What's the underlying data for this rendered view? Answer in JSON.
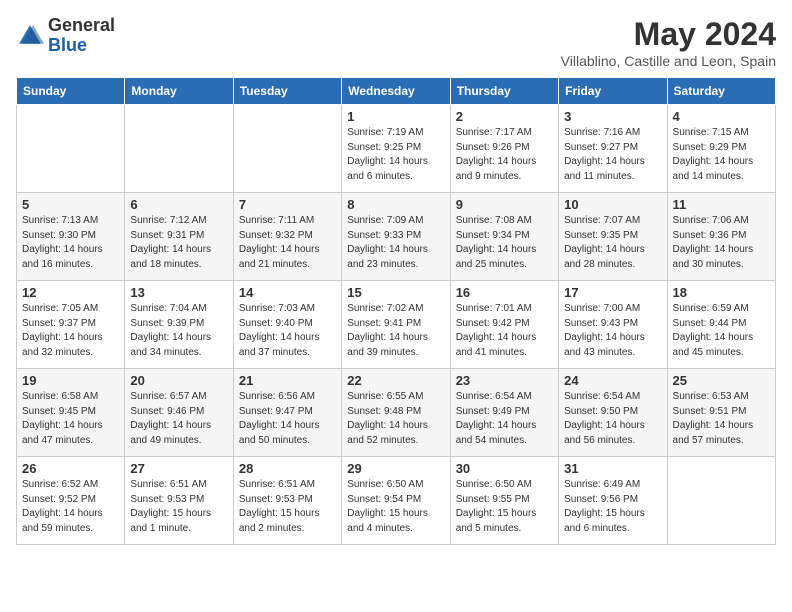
{
  "header": {
    "logo_general": "General",
    "logo_blue": "Blue",
    "month_year": "May 2024",
    "location": "Villablino, Castille and Leon, Spain"
  },
  "weekdays": [
    "Sunday",
    "Monday",
    "Tuesday",
    "Wednesday",
    "Thursday",
    "Friday",
    "Saturday"
  ],
  "weeks": [
    [
      {
        "day": "",
        "detail": ""
      },
      {
        "day": "",
        "detail": ""
      },
      {
        "day": "",
        "detail": ""
      },
      {
        "day": "1",
        "detail": "Sunrise: 7:19 AM\nSunset: 9:25 PM\nDaylight: 14 hours\nand 6 minutes."
      },
      {
        "day": "2",
        "detail": "Sunrise: 7:17 AM\nSunset: 9:26 PM\nDaylight: 14 hours\nand 9 minutes."
      },
      {
        "day": "3",
        "detail": "Sunrise: 7:16 AM\nSunset: 9:27 PM\nDaylight: 14 hours\nand 11 minutes."
      },
      {
        "day": "4",
        "detail": "Sunrise: 7:15 AM\nSunset: 9:29 PM\nDaylight: 14 hours\nand 14 minutes."
      }
    ],
    [
      {
        "day": "5",
        "detail": "Sunrise: 7:13 AM\nSunset: 9:30 PM\nDaylight: 14 hours\nand 16 minutes."
      },
      {
        "day": "6",
        "detail": "Sunrise: 7:12 AM\nSunset: 9:31 PM\nDaylight: 14 hours\nand 18 minutes."
      },
      {
        "day": "7",
        "detail": "Sunrise: 7:11 AM\nSunset: 9:32 PM\nDaylight: 14 hours\nand 21 minutes."
      },
      {
        "day": "8",
        "detail": "Sunrise: 7:09 AM\nSunset: 9:33 PM\nDaylight: 14 hours\nand 23 minutes."
      },
      {
        "day": "9",
        "detail": "Sunrise: 7:08 AM\nSunset: 9:34 PM\nDaylight: 14 hours\nand 25 minutes."
      },
      {
        "day": "10",
        "detail": "Sunrise: 7:07 AM\nSunset: 9:35 PM\nDaylight: 14 hours\nand 28 minutes."
      },
      {
        "day": "11",
        "detail": "Sunrise: 7:06 AM\nSunset: 9:36 PM\nDaylight: 14 hours\nand 30 minutes."
      }
    ],
    [
      {
        "day": "12",
        "detail": "Sunrise: 7:05 AM\nSunset: 9:37 PM\nDaylight: 14 hours\nand 32 minutes."
      },
      {
        "day": "13",
        "detail": "Sunrise: 7:04 AM\nSunset: 9:39 PM\nDaylight: 14 hours\nand 34 minutes."
      },
      {
        "day": "14",
        "detail": "Sunrise: 7:03 AM\nSunset: 9:40 PM\nDaylight: 14 hours\nand 37 minutes."
      },
      {
        "day": "15",
        "detail": "Sunrise: 7:02 AM\nSunset: 9:41 PM\nDaylight: 14 hours\nand 39 minutes."
      },
      {
        "day": "16",
        "detail": "Sunrise: 7:01 AM\nSunset: 9:42 PM\nDaylight: 14 hours\nand 41 minutes."
      },
      {
        "day": "17",
        "detail": "Sunrise: 7:00 AM\nSunset: 9:43 PM\nDaylight: 14 hours\nand 43 minutes."
      },
      {
        "day": "18",
        "detail": "Sunrise: 6:59 AM\nSunset: 9:44 PM\nDaylight: 14 hours\nand 45 minutes."
      }
    ],
    [
      {
        "day": "19",
        "detail": "Sunrise: 6:58 AM\nSunset: 9:45 PM\nDaylight: 14 hours\nand 47 minutes."
      },
      {
        "day": "20",
        "detail": "Sunrise: 6:57 AM\nSunset: 9:46 PM\nDaylight: 14 hours\nand 49 minutes."
      },
      {
        "day": "21",
        "detail": "Sunrise: 6:56 AM\nSunset: 9:47 PM\nDaylight: 14 hours\nand 50 minutes."
      },
      {
        "day": "22",
        "detail": "Sunrise: 6:55 AM\nSunset: 9:48 PM\nDaylight: 14 hours\nand 52 minutes."
      },
      {
        "day": "23",
        "detail": "Sunrise: 6:54 AM\nSunset: 9:49 PM\nDaylight: 14 hours\nand 54 minutes."
      },
      {
        "day": "24",
        "detail": "Sunrise: 6:54 AM\nSunset: 9:50 PM\nDaylight: 14 hours\nand 56 minutes."
      },
      {
        "day": "25",
        "detail": "Sunrise: 6:53 AM\nSunset: 9:51 PM\nDaylight: 14 hours\nand 57 minutes."
      }
    ],
    [
      {
        "day": "26",
        "detail": "Sunrise: 6:52 AM\nSunset: 9:52 PM\nDaylight: 14 hours\nand 59 minutes."
      },
      {
        "day": "27",
        "detail": "Sunrise: 6:51 AM\nSunset: 9:53 PM\nDaylight: 15 hours\nand 1 minute."
      },
      {
        "day": "28",
        "detail": "Sunrise: 6:51 AM\nSunset: 9:53 PM\nDaylight: 15 hours\nand 2 minutes."
      },
      {
        "day": "29",
        "detail": "Sunrise: 6:50 AM\nSunset: 9:54 PM\nDaylight: 15 hours\nand 4 minutes."
      },
      {
        "day": "30",
        "detail": "Sunrise: 6:50 AM\nSunset: 9:55 PM\nDaylight: 15 hours\nand 5 minutes."
      },
      {
        "day": "31",
        "detail": "Sunrise: 6:49 AM\nSunset: 9:56 PM\nDaylight: 15 hours\nand 6 minutes."
      },
      {
        "day": "",
        "detail": ""
      }
    ]
  ]
}
